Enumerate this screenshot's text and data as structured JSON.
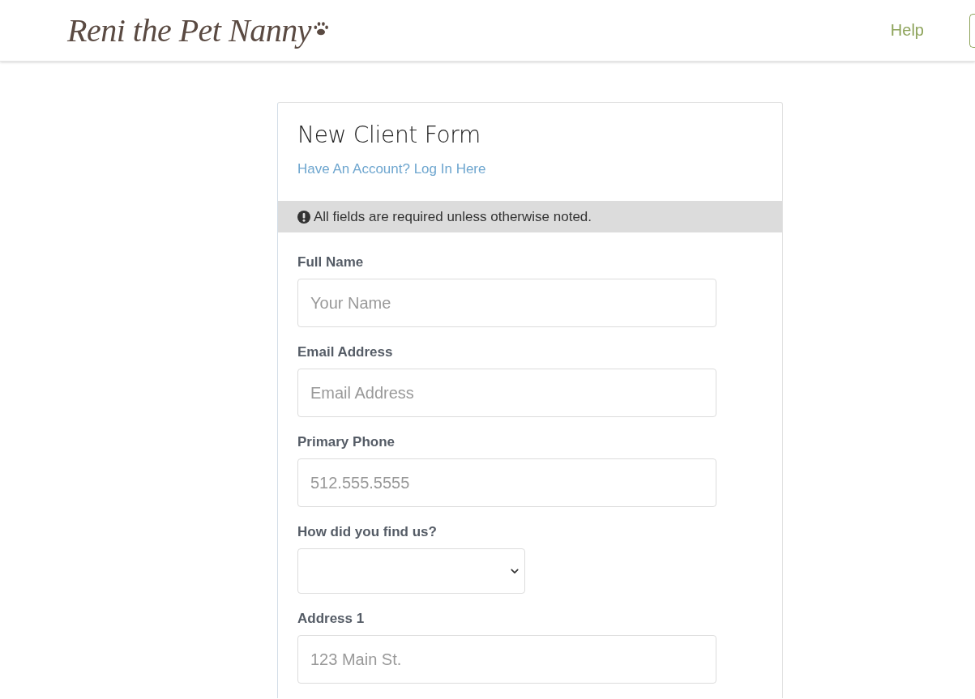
{
  "header": {
    "logo": "Reni the Pet Nanny",
    "nav": [
      {
        "kind": "link",
        "label": "Help"
      },
      {
        "kind": "button"
      }
    ]
  },
  "form": {
    "title": "New Client Form",
    "login_link": "Have An Account? Log In Here",
    "notice": "All fields are required unless otherwise noted.",
    "fields": [
      {
        "kind": "text",
        "label": "Full Name",
        "placeholder": "Your Name"
      },
      {
        "kind": "text",
        "label": "Email Address",
        "placeholder": "Email Address"
      },
      {
        "kind": "text",
        "label": "Primary Phone",
        "placeholder": "512.555.5555"
      },
      {
        "kind": "select",
        "label": "How did you find us?"
      },
      {
        "kind": "text",
        "label": "Address 1",
        "placeholder": "123 Main St."
      }
    ]
  }
}
